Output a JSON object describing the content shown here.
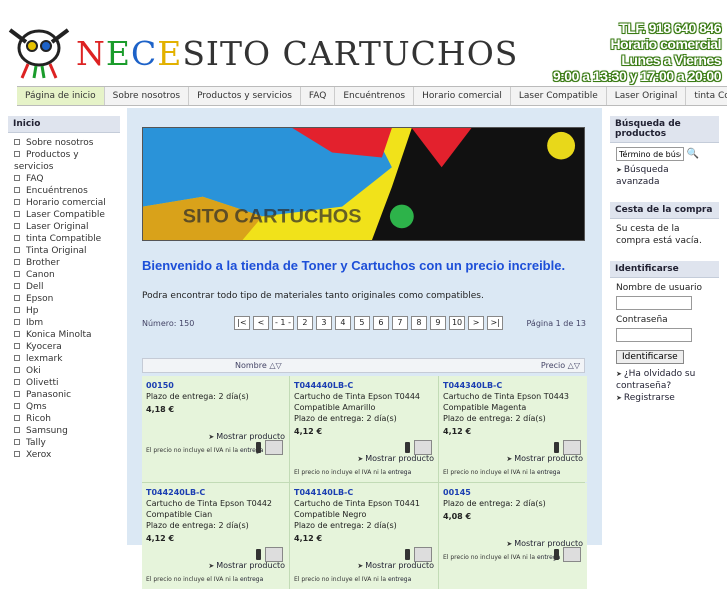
{
  "header": {
    "logo_letters": [
      "N",
      "E",
      "C",
      "E",
      "SITO CARTUCHOS"
    ],
    "contact": [
      "TLF. 918 640 846",
      "Horario comercial",
      "Lunes a Viernes",
      "9:00 a 13:30 y 17:00 a 20:00"
    ]
  },
  "nav": [
    "Página de inicio",
    "Sobre nosotros",
    "Productos y servicios",
    "FAQ",
    "Encuéntrenos",
    "Horario comercial",
    "Laser Compatible",
    "Laser Original",
    "tinta Compatible"
  ],
  "left": {
    "title": "Inicio",
    "items": [
      "Sobre nosotros",
      "Productos y servicios",
      "FAQ",
      "Encuéntrenos",
      "Horario comercial",
      "Laser Compatible",
      "Laser Original",
      "tinta Compatible",
      "Tinta Original",
      "Brother",
      "Canon",
      "Dell",
      "Epson",
      "Hp",
      "Ibm",
      "Konica Minolta",
      "Kyocera",
      "lexmark",
      "Oki",
      "Olivetti",
      "Panasonic",
      "Qms",
      "Ricoh",
      "Samsung",
      "Tally",
      "Xerox"
    ]
  },
  "right": {
    "search_title": "Búsqueda de productos",
    "search_value": "Término de búsq",
    "advanced": "Búsqueda avanzada",
    "cart_title": "Cesta de la compra",
    "cart_text": "Su cesta de la compra está vacía.",
    "login_title": "Identificarse",
    "username": "Nombre de usuario",
    "password": "Contraseña",
    "login_button": "Identificarse",
    "forgot": "¿Ha olvidado su contraseña?",
    "register": "Registrarse"
  },
  "main": {
    "welcome": "Bienvenido a la tienda de Toner y Cartuchos con un precio increible.",
    "sub": "Podra encontrar todo tipo de materiales tanto originales como compatibles.",
    "count": "Número: 150",
    "pages": [
      "|<",
      "<",
      "- 1 -",
      "2",
      "3",
      "4",
      "5",
      "6",
      "7",
      "8",
      "9",
      "10",
      ">",
      ">|"
    ],
    "page_info": "Página 1 de 13",
    "col_name": "Nombre △▽",
    "col_price": "Precio △▽",
    "more": "Mostrar producto",
    "iva": "El precio no incluye el IVA ni la",
    "iva_link": "entrega",
    "products": [
      {
        "code": "00150",
        "name": "",
        "delivery": "Plazo de entrega: 2 día(s)",
        "price": "4,18 €"
      },
      {
        "code": "T044440LB-C",
        "name": "Cartucho de Tinta Epson T0444 Compatible Amarillo",
        "delivery": "Plazo de entrega: 2 día(s)",
        "price": "4,12 €"
      },
      {
        "code": "T044340LB-C",
        "name": "Cartucho de Tinta Epson T0443 Compatible Magenta",
        "delivery": "Plazo de entrega: 2 día(s)",
        "price": "4,12 €"
      },
      {
        "code": "T044240LB-C",
        "name": "Cartucho de Tinta Epson T0442 Compatible Cian",
        "delivery": "Plazo de entrega: 2 día(s)",
        "price": "4,12 €"
      },
      {
        "code": "T044140LB-C",
        "name": "Cartucho de Tinta Epson T0441 Compatible Negro",
        "delivery": "Plazo de entrega: 2 día(s)",
        "price": "4,12 €"
      },
      {
        "code": "00145",
        "name": "",
        "delivery": "Plazo de entrega: 2 día(s)",
        "price": "4,08 €"
      }
    ]
  },
  "colors": {
    "accent": "#1d4fd8",
    "panel": "#dbe8f4",
    "cell": "#e6f4db"
  }
}
